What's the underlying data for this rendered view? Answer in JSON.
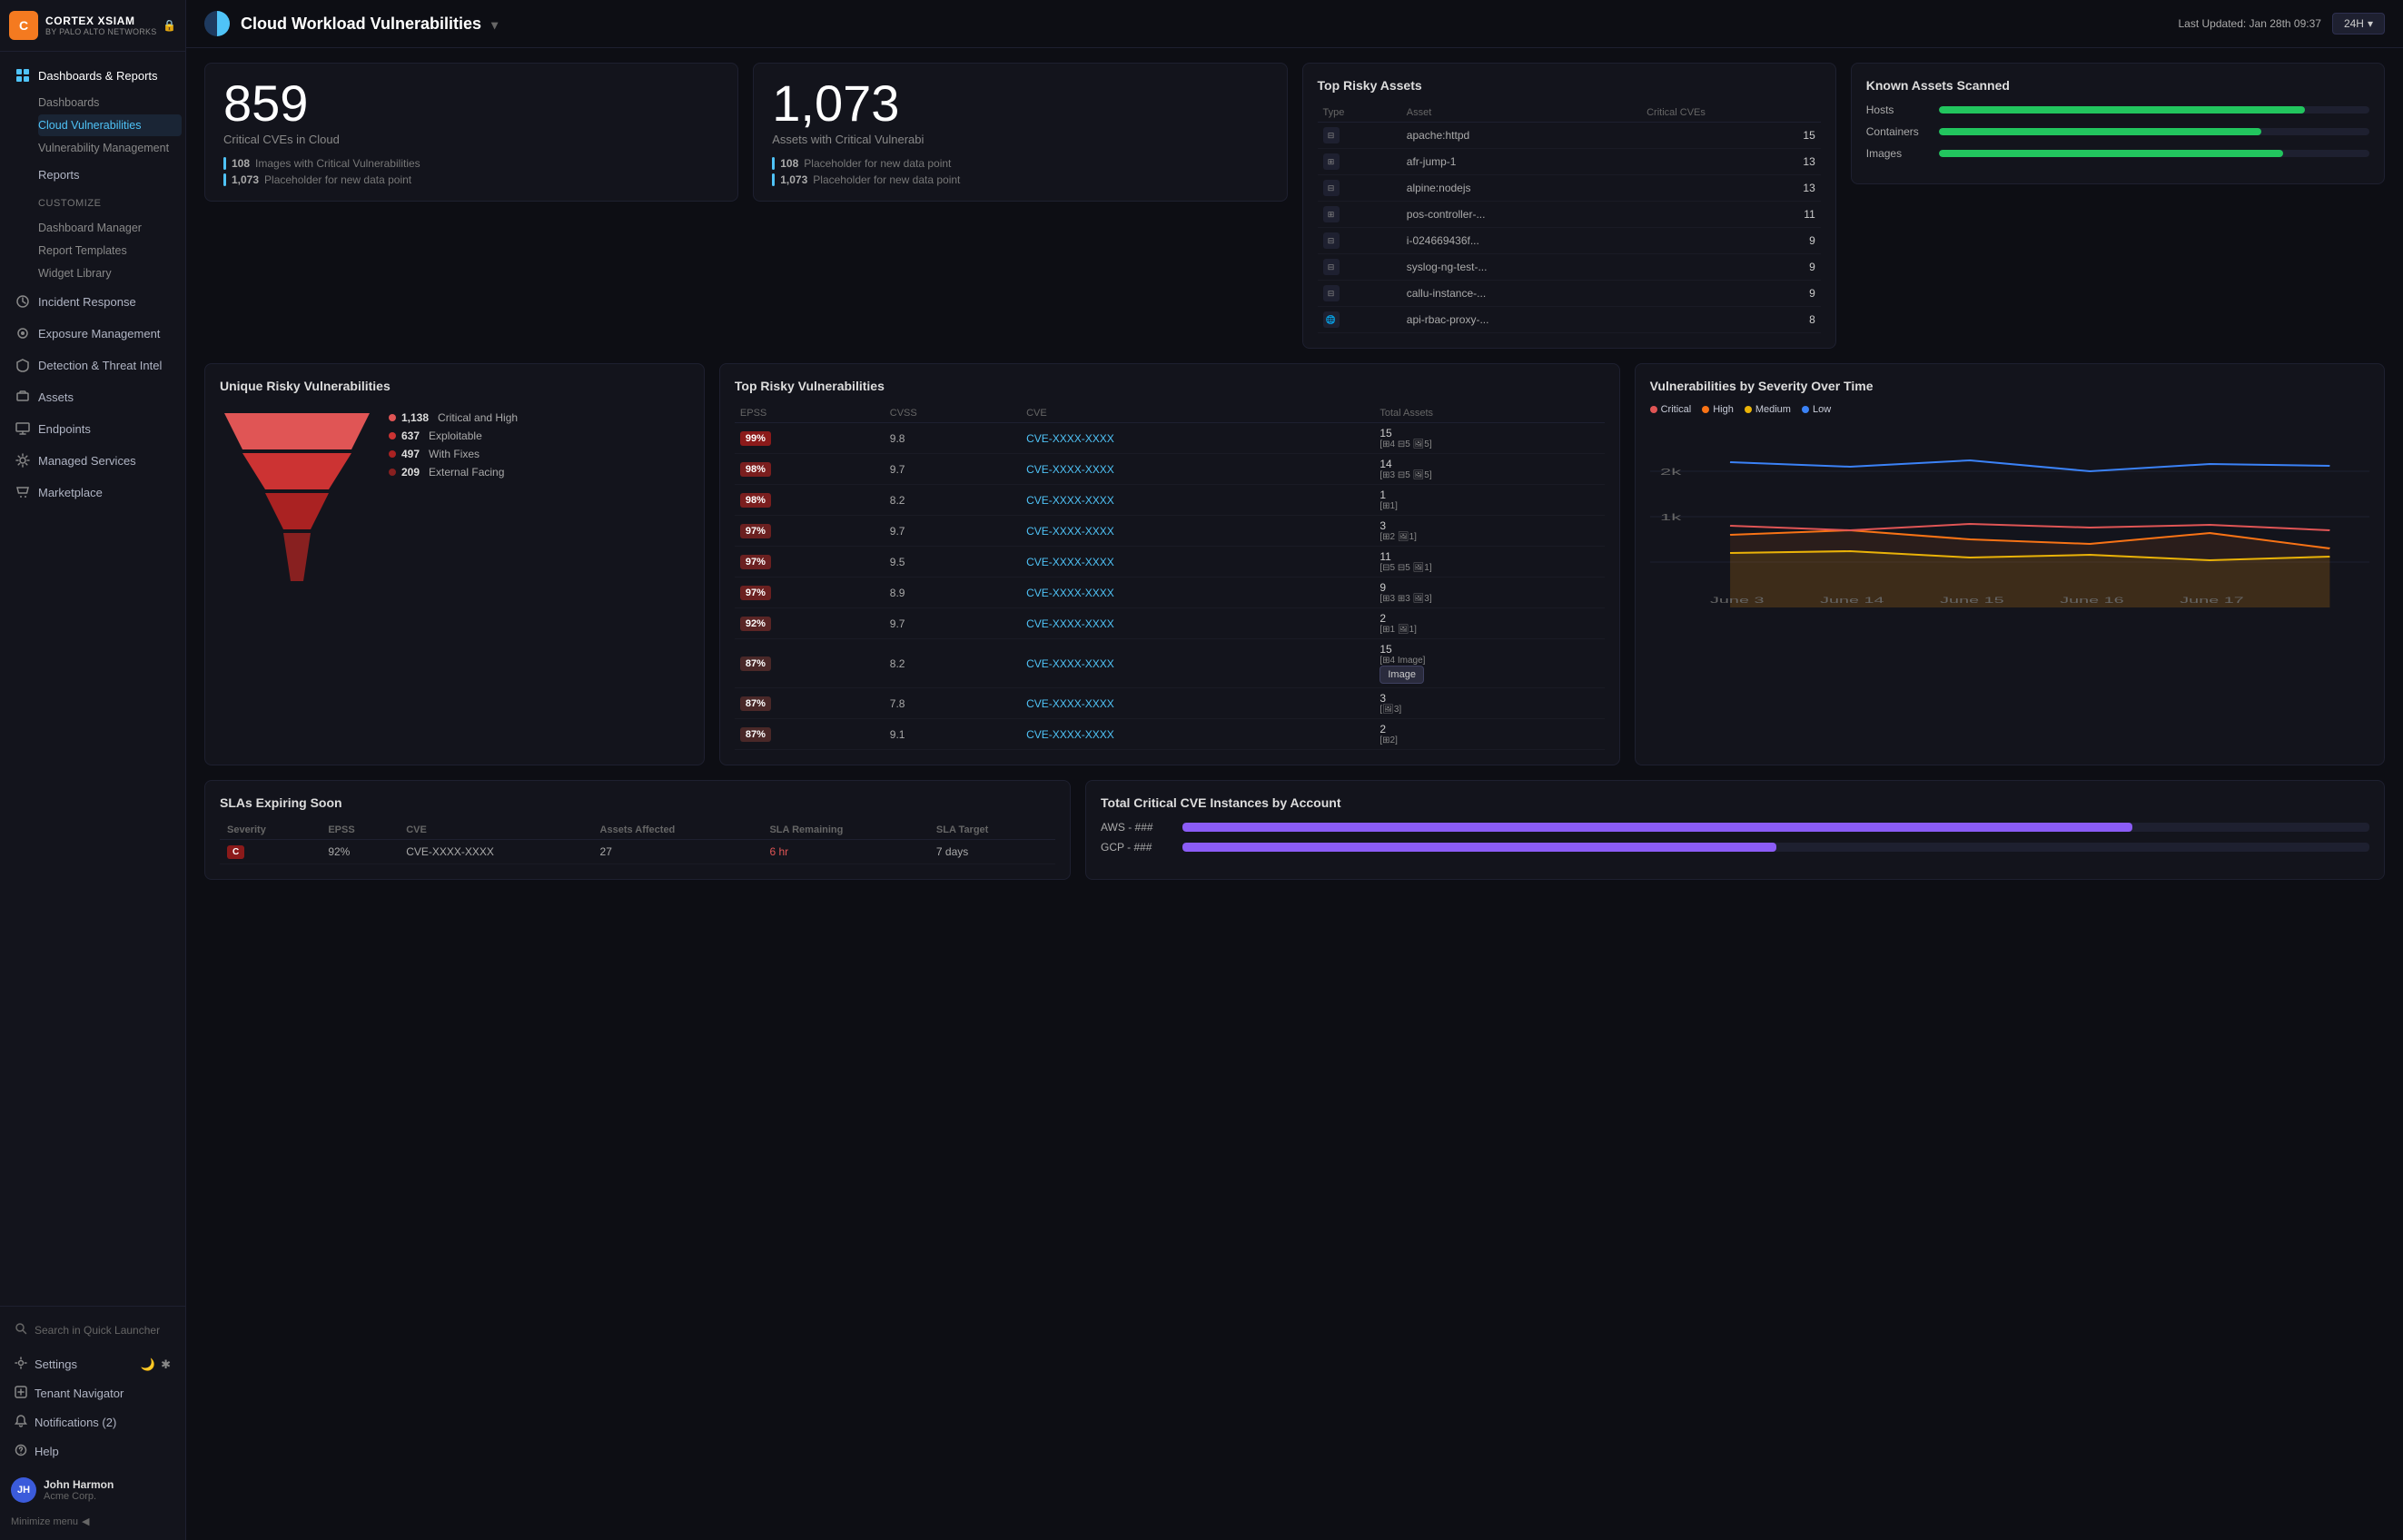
{
  "app": {
    "logo_letter": "C",
    "brand": "CORTEX XSIAM",
    "brand_sub": "BY PALO ALTO NETWORKS",
    "lock_icon": "🔒"
  },
  "sidebar": {
    "sections": [
      {
        "id": "dashboards-reports",
        "label": "Dashboards & Reports",
        "icon": "⊞",
        "expanded": true,
        "children": [
          {
            "id": "dashboards",
            "label": "Dashboards",
            "active": false
          },
          {
            "id": "cloud-vulnerabilities",
            "label": "Cloud Vulnerabilities",
            "active": true
          },
          {
            "id": "vulnerability-management",
            "label": "Vulnerability Management",
            "active": false
          }
        ]
      },
      {
        "id": "reports",
        "label": "Reports",
        "icon": "📄",
        "indent": true
      },
      {
        "id": "customize",
        "label": "Customize",
        "icon": "",
        "indent": true,
        "children": [
          {
            "id": "dashboard-manager",
            "label": "Dashboard Manager"
          },
          {
            "id": "report-templates",
            "label": "Report Templates"
          },
          {
            "id": "widget-library",
            "label": "Widget Library"
          }
        ]
      },
      {
        "id": "incident-response",
        "label": "Incident Response",
        "icon": "⚡"
      },
      {
        "id": "exposure-management",
        "label": "Exposure Management",
        "icon": "🔍"
      },
      {
        "id": "detection-threat-intel",
        "label": "Detection & Threat Intel",
        "icon": "🛡"
      },
      {
        "id": "assets",
        "label": "Assets",
        "icon": "💾"
      },
      {
        "id": "endpoints",
        "label": "Endpoints",
        "icon": "🖥"
      },
      {
        "id": "managed-services",
        "label": "Managed Services",
        "icon": "🔧"
      },
      {
        "id": "marketplace",
        "label": "Marketplace",
        "icon": "🛒"
      }
    ],
    "search_placeholder": "Search in Quick Launcher",
    "settings_label": "Settings",
    "tenant_navigator_label": "Tenant Navigator",
    "notifications_label": "Notifications (2)",
    "help_label": "Help",
    "user": {
      "initials": "JH",
      "name": "John Harmon",
      "org": "Acme Corp."
    },
    "minimize_label": "Minimize menu"
  },
  "topbar": {
    "page_title": "Cloud Workload Vulnerabilities",
    "last_updated_label": "Last Updated:",
    "last_updated_value": "Jan 28th 09:37",
    "time_range": "24H"
  },
  "stats": {
    "critical_cves": {
      "number": "859",
      "label": "Critical CVEs in Cloud",
      "sub1_count": "108",
      "sub1_label": "Images with Critical Vulnerabilities",
      "sub2_count": "1,073",
      "sub2_label": "Placeholder for new data point"
    },
    "assets_critical": {
      "number": "1,073",
      "label": "Assets with Critical Vulnerabi",
      "sub1_count": "108",
      "sub1_label": "Placeholder for new data point",
      "sub2_count": "1,073",
      "sub2_label": "Placeholder for new data point"
    }
  },
  "risky_assets": {
    "title": "Top Risky Assets",
    "columns": [
      "Type",
      "Asset",
      "Critical CVEs"
    ],
    "rows": [
      {
        "type": "server",
        "asset": "apache:httpd",
        "cves": "15"
      },
      {
        "type": "vm",
        "asset": "afr-jump-1",
        "cves": "13"
      },
      {
        "type": "server",
        "asset": "alpine:nodejs",
        "cves": "13"
      },
      {
        "type": "vm",
        "asset": "pos-controller-...",
        "cves": "11"
      },
      {
        "type": "server",
        "asset": "i-024669436f...",
        "cves": "9"
      },
      {
        "type": "server",
        "asset": "syslog-ng-test-...",
        "cves": "9"
      },
      {
        "type": "server",
        "asset": "callu-instance-...",
        "cves": "9"
      },
      {
        "type": "globe",
        "asset": "api-rbac-proxy-...",
        "cves": "8"
      }
    ]
  },
  "known_assets": {
    "title": "Known Assets Scanned",
    "bars": [
      {
        "label": "Hosts",
        "fill": "#22c55e",
        "width": 85
      },
      {
        "label": "Containers",
        "fill": "#22c55e",
        "width": 75
      },
      {
        "label": "Images",
        "fill": "#22c55e",
        "width": 80
      }
    ]
  },
  "unique_vulns": {
    "title": "Unique Risky Vulnerabilities",
    "funnel": [
      {
        "label": "Critical and High",
        "count": "1,138",
        "color": "#e05555",
        "width": 160,
        "height": 30
      },
      {
        "label": "Exploitable",
        "count": "637",
        "color": "#cc3333",
        "width": 130,
        "height": 30
      },
      {
        "label": "With Fixes",
        "count": "497",
        "color": "#aa2222",
        "width": 100,
        "height": 30
      },
      {
        "label": "External Facing",
        "count": "209",
        "color": "#882020",
        "width": 60,
        "height": 40
      }
    ]
  },
  "top_vulns": {
    "title": "Top Risky Vulnerabilities",
    "columns": [
      "EPSS",
      "CVSS",
      "CVE",
      "Total Assets"
    ],
    "rows": [
      {
        "epss": "99%",
        "cvss": "9.8",
        "cve": "CVE-XXXX-XXXX",
        "total": "15",
        "icons": "[⊞4 ⊟5 🖼5]",
        "epss_class": "epss-99"
      },
      {
        "epss": "98%",
        "cvss": "9.7",
        "cve": "CVE-XXXX-XXXX",
        "total": "14",
        "icons": "[⊞3 ⊟5 🖼5]",
        "epss_class": "epss-98"
      },
      {
        "epss": "98%",
        "cvss": "8.2",
        "cve": "CVE-XXXX-XXXX",
        "total": "1",
        "icons": "[⊞1]",
        "epss_class": "epss-98"
      },
      {
        "epss": "97%",
        "cvss": "9.7",
        "cve": "CVE-XXXX-XXXX",
        "total": "3",
        "icons": "[⊞2 🖼1]",
        "epss_class": "epss-97"
      },
      {
        "epss": "97%",
        "cvss": "9.5",
        "cve": "CVE-XXXX-XXXX",
        "total": "11",
        "icons": "[⊟5 ⊟5 🖼1]",
        "epss_class": "epss-97"
      },
      {
        "epss": "97%",
        "cvss": "8.9",
        "cve": "CVE-XXXX-XXXX",
        "total": "9",
        "icons": "[⊞3 ⊞3 🖼3]",
        "epss_class": "epss-97"
      },
      {
        "epss": "92%",
        "cvss": "9.7",
        "cve": "CVE-XXXX-XXXX",
        "total": "2",
        "icons": "[⊞1 🖼1]",
        "epss_class": "epss-92"
      },
      {
        "epss": "87%",
        "cvss": "8.2",
        "cve": "CVE-XXXX-XXXX",
        "total": "15",
        "icons": "[⊞4 Image]",
        "epss_class": "epss-87",
        "tooltip": "Image"
      },
      {
        "epss": "87%",
        "cvss": "7.8",
        "cve": "CVE-XXXX-XXXX",
        "total": "3",
        "icons": "[🖼3]",
        "epss_class": "epss-87"
      },
      {
        "epss": "87%",
        "cvss": "9.1",
        "cve": "CVE-XXXX-XXXX",
        "total": "2",
        "icons": "[⊞2]",
        "epss_class": "epss-87"
      }
    ]
  },
  "severity_chart": {
    "title": "Vulnerabilities by Severity Over Time",
    "legend": [
      {
        "label": "Critical",
        "color": "#e05555"
      },
      {
        "label": "High",
        "color": "#f97316"
      },
      {
        "label": "Medium",
        "color": "#eab308"
      },
      {
        "label": "Low",
        "color": "#3b82f6"
      }
    ],
    "x_labels": [
      "June 3",
      "June 14",
      "June 15",
      "June 16",
      "June 17"
    ],
    "y_labels": [
      "2k",
      "1k"
    ]
  },
  "slas": {
    "title": "SLAs Expiring Soon",
    "columns": [
      "Severity",
      "EPSS",
      "CVE",
      "Assets Affected",
      "SLA Remaining",
      "SLA Target"
    ],
    "rows": [
      {
        "sev": "C",
        "epss": "92%",
        "cve": "CVE-XXXX-XXXX",
        "assets": "27",
        "sla_remaining": "6 hr",
        "sla_target": "7 days"
      }
    ]
  },
  "cve_by_account": {
    "title": "Total Critical CVE Instances by Account",
    "rows": [
      {
        "label": "AWS - ###",
        "fill": "#8b5cf6",
        "width": 80
      },
      {
        "label": "GCP - ###",
        "fill": "#8b5cf6",
        "width": 50
      }
    ]
  }
}
